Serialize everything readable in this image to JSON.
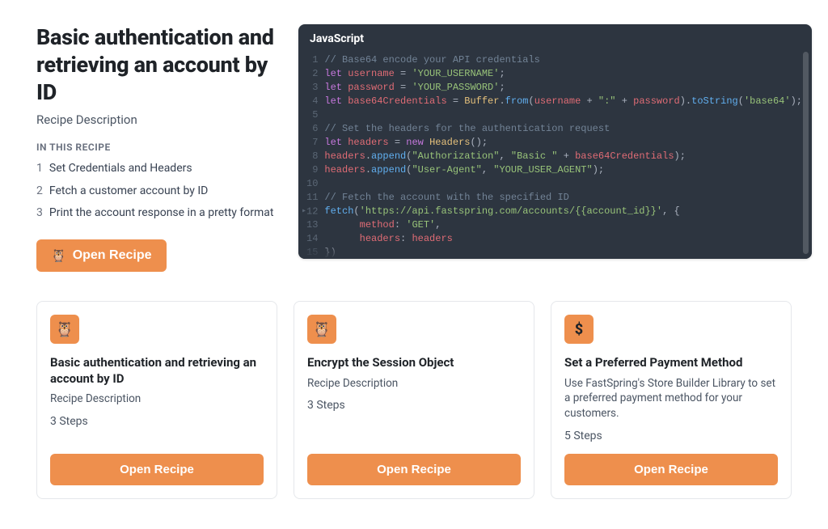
{
  "header": {
    "title": "Basic authentication and retrieving an account by ID",
    "subtitle": "Recipe Description",
    "in_this_label": "IN THIS RECIPE",
    "steps": [
      {
        "num": "1",
        "label": "Set Credentials and Headers"
      },
      {
        "num": "2",
        "label": "Fetch a customer account by ID"
      },
      {
        "num": "3",
        "label": "Print the account response in a pretty format"
      }
    ],
    "open_label": "Open Recipe"
  },
  "code": {
    "lang": "JavaScript"
  },
  "cards": [
    {
      "icon": "🦉",
      "title": "Basic authentication and retrieving an account by ID",
      "desc": "Recipe Description",
      "steps": "3 Steps",
      "button": "Open Recipe"
    },
    {
      "icon": "🦉",
      "title": "Encrypt the Session Object",
      "desc": "Recipe Description",
      "steps": "3 Steps",
      "button": "Open Recipe"
    },
    {
      "icon": "$",
      "title": "Set a Preferred Payment Method",
      "desc": "Use FastSpring's Store Builder Library to set a preferred payment method for your customers.",
      "steps": "5 Steps",
      "button": "Open Recipe"
    }
  ]
}
